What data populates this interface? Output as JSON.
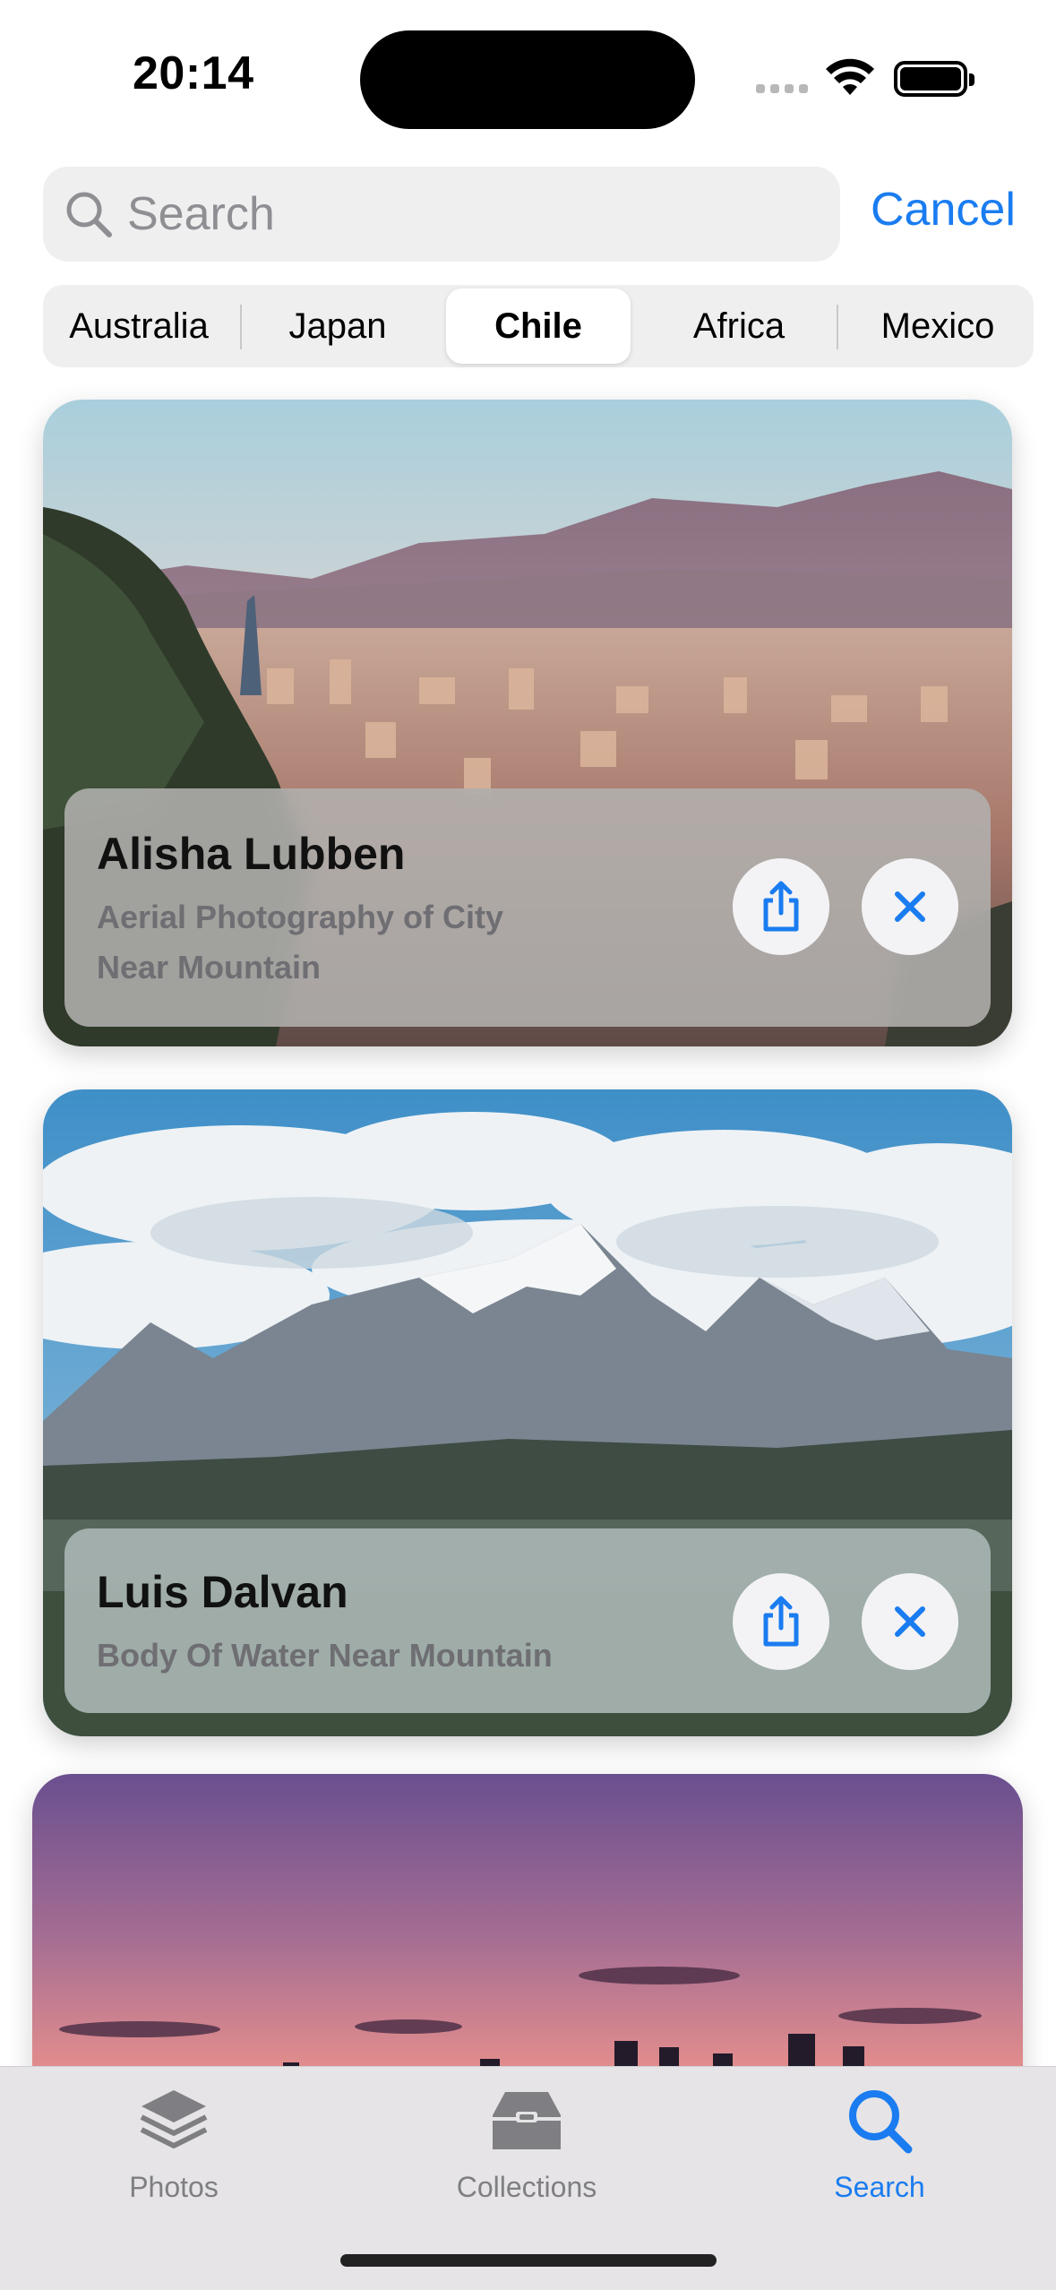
{
  "status": {
    "time": "20:14"
  },
  "search": {
    "placeholder": "Search",
    "value": "",
    "cancel_label": "Cancel"
  },
  "segments": {
    "items": [
      "Australia",
      "Japan",
      "Chile",
      "Africa",
      "Mexico"
    ],
    "selected": "Chile"
  },
  "cards": [
    {
      "author": "Alisha Lubben",
      "description": "Aerial Photography of City\nNear Mountain"
    },
    {
      "author": "Luis Dalvan",
      "description": "Body Of Water Near Mountain"
    },
    {
      "author": "",
      "description": ""
    }
  ],
  "tabbar": {
    "items": [
      {
        "label": "Photos",
        "icon": "stack-icon"
      },
      {
        "label": "Collections",
        "icon": "tray-icon"
      },
      {
        "label": "Search",
        "icon": "magnifier-icon"
      }
    ],
    "active": "Search"
  },
  "colors": {
    "accent": "#1a7cf0",
    "inactive_tab": "#7f7f83"
  }
}
